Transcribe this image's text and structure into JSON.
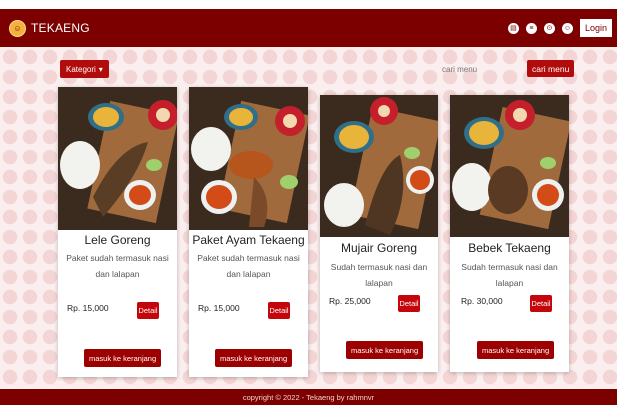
{
  "navbar": {
    "brand": "TEKAENG",
    "logo_glyph": "☺",
    "icons": [
      "clipboard-icon",
      "list-icon",
      "cart-icon",
      "user-icon"
    ],
    "icon_glyphs": [
      "▤",
      "≡",
      "⊙",
      "☺"
    ],
    "login": "Login"
  },
  "filters": {
    "dropdown_label": "Kategori",
    "dropdown_caret": "▾",
    "search_placeholder": "cari menu",
    "search_button": "cari menu"
  },
  "cards": [
    {
      "name": "Lele Goreng",
      "desc": "Paket sudah termasuk nasi dan lalapan",
      "price": "Rp. 15,000",
      "detail": "Detail",
      "cart": "masuk ke keranjang"
    },
    {
      "name": "Paket Ayam Tekaeng",
      "desc": "Paket sudah termasuk nasi dan lalapan",
      "price": "Rp. 15,000",
      "detail": "Detail",
      "cart": "masuk ke keranjang"
    },
    {
      "name": "Mujair Goreng",
      "desc": "Sudah termasuk nasi dan lalapan",
      "price": "Rp. 25,000",
      "detail": "Detail",
      "cart": "masuk ke keranjang"
    },
    {
      "name": "Bebek Tekaeng",
      "desc": "Sudah termasuk nasi dan lalapan",
      "price": "Rp. 30,000",
      "detail": "Detail",
      "cart": "masuk ke keranjang"
    }
  ],
  "footer": {
    "text": "copyright © 2022 - Tekaeng by rahmnvr"
  },
  "colors": {
    "navbar": "#7c0000",
    "button": "#c4060b",
    "cart_button": "#9c0000",
    "background": "#fbeeee"
  }
}
